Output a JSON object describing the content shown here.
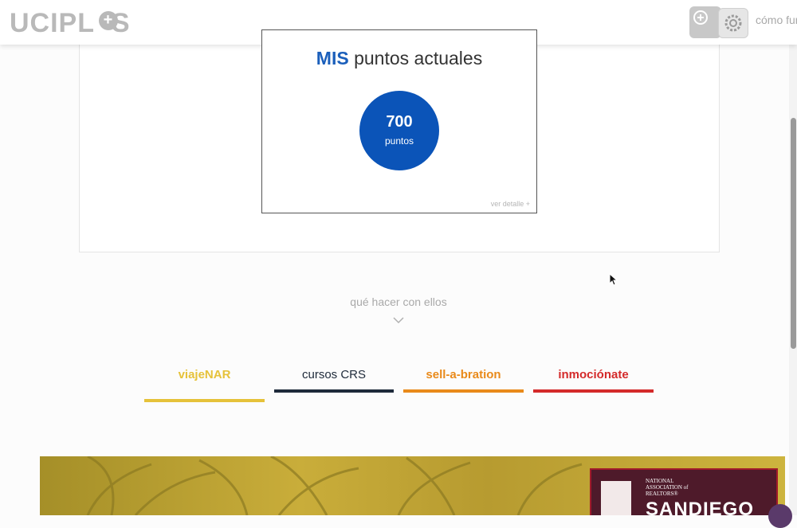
{
  "header": {
    "logo_text": "UCIPL  S",
    "logo_plus": "+",
    "como_label": "cómo funciona"
  },
  "points_card": {
    "title_bold": "MIS",
    "title_rest": " puntos actuales",
    "points_value": "700",
    "points_unit": "puntos",
    "detail_link": "ver detalle +"
  },
  "section": {
    "que_hacer": "qué hacer con ellos"
  },
  "tabs": [
    {
      "label": "viajeNAR",
      "color": "#e6c23a"
    },
    {
      "label": "cursos CRS",
      "color": "#1e2a3a"
    },
    {
      "label": "sell-a-bration",
      "color": "#e98a1a"
    },
    {
      "label": "inmociónate",
      "color": "#d42a2a"
    }
  ],
  "banner": {
    "nar_small": "NATIONAL ASSOCIATION of REALTORS®",
    "nar_big": "SANDIEGO"
  },
  "colors": {
    "primary_blue": "#0b54b8",
    "logo_gray": "#b9b9b9"
  }
}
